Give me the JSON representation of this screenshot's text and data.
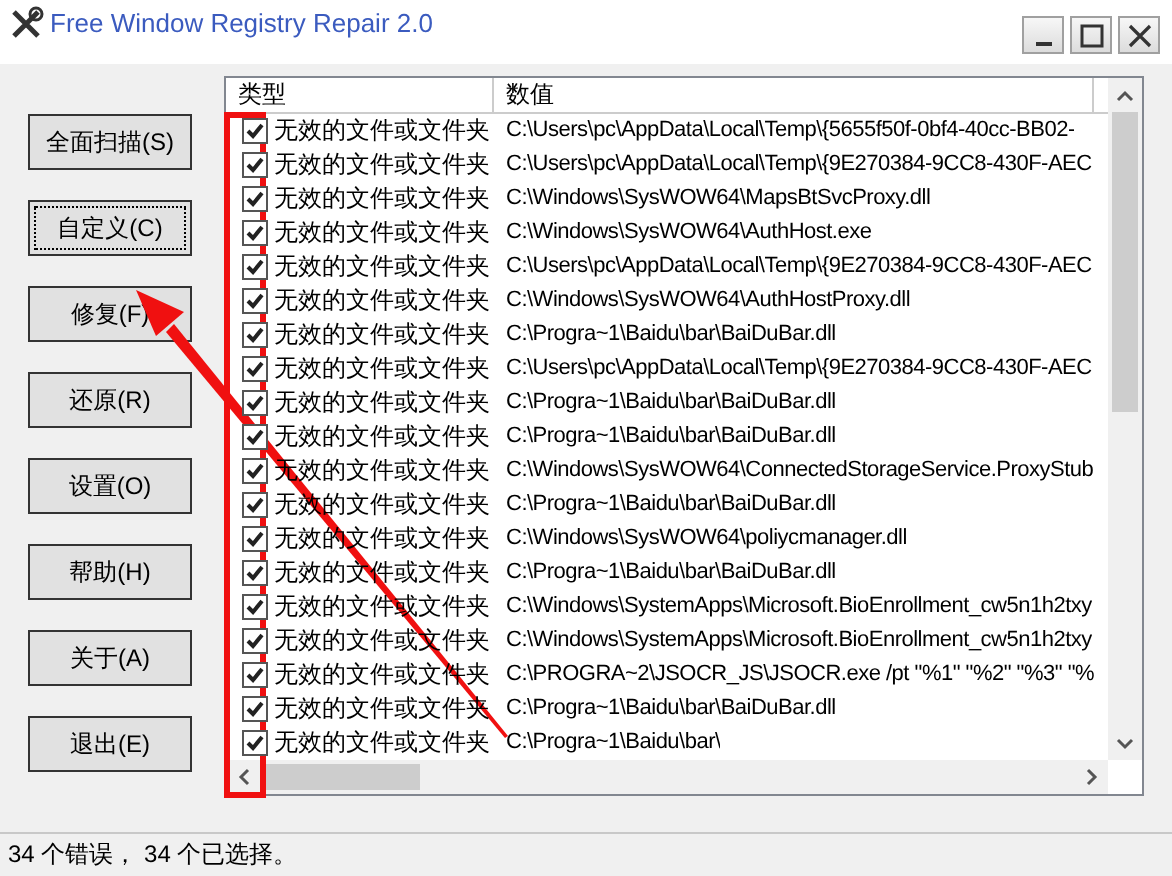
{
  "window": {
    "title": "Free Window Registry Repair 2.0"
  },
  "buttons": [
    {
      "label": "全面扫描(S)",
      "focused": false
    },
    {
      "label": "自定义(C)",
      "focused": true
    },
    {
      "label": "修复(F)",
      "focused": false
    },
    {
      "label": "还原(R)",
      "focused": false
    },
    {
      "label": "设置(O)",
      "focused": false
    },
    {
      "label": "帮助(H)",
      "focused": false
    },
    {
      "label": "关于(A)",
      "focused": false
    },
    {
      "label": "退出(E)",
      "focused": false
    }
  ],
  "table": {
    "columns": [
      "类型",
      "数值"
    ],
    "rows": [
      {
        "checked": true,
        "type": "无效的文件或文件夹",
        "value": "C:\\Users\\pc\\AppData\\Local\\Temp\\{5655f50f-0bf4-40cc-BB02-"
      },
      {
        "checked": true,
        "type": "无效的文件或文件夹",
        "value": "C:\\Users\\pc\\AppData\\Local\\Temp\\{9E270384-9CC8-430F-AEC"
      },
      {
        "checked": true,
        "type": "无效的文件或文件夹",
        "value": "C:\\Windows\\SysWOW64\\MapsBtSvcProxy.dll"
      },
      {
        "checked": true,
        "type": "无效的文件或文件夹",
        "value": "C:\\Windows\\SysWOW64\\AuthHost.exe"
      },
      {
        "checked": true,
        "type": "无效的文件或文件夹",
        "value": "C:\\Users\\pc\\AppData\\Local\\Temp\\{9E270384-9CC8-430F-AEC"
      },
      {
        "checked": true,
        "type": "无效的文件或文件夹",
        "value": "C:\\Windows\\SysWOW64\\AuthHostProxy.dll"
      },
      {
        "checked": true,
        "type": "无效的文件或文件夹",
        "value": "C:\\Progra~1\\Baidu\\bar\\BaiDuBar.dll"
      },
      {
        "checked": true,
        "type": "无效的文件或文件夹",
        "value": "C:\\Users\\pc\\AppData\\Local\\Temp\\{9E270384-9CC8-430F-AEC"
      },
      {
        "checked": true,
        "type": "无效的文件或文件夹",
        "value": "C:\\Progra~1\\Baidu\\bar\\BaiDuBar.dll"
      },
      {
        "checked": true,
        "type": "无效的文件或文件夹",
        "value": "C:\\Progra~1\\Baidu\\bar\\BaiDuBar.dll"
      },
      {
        "checked": true,
        "type": "无效的文件或文件夹",
        "value": "C:\\Windows\\SysWOW64\\ConnectedStorageService.ProxyStub"
      },
      {
        "checked": true,
        "type": "无效的文件或文件夹",
        "value": "C:\\Progra~1\\Baidu\\bar\\BaiDuBar.dll"
      },
      {
        "checked": true,
        "type": "无效的文件或文件夹",
        "value": "C:\\Windows\\SysWOW64\\poliycmanager.dll"
      },
      {
        "checked": true,
        "type": "无效的文件或文件夹",
        "value": "C:\\Progra~1\\Baidu\\bar\\BaiDuBar.dll"
      },
      {
        "checked": true,
        "type": "无效的文件或文件夹",
        "value": "C:\\Windows\\SystemApps\\Microsoft.BioEnrollment_cw5n1h2txy"
      },
      {
        "checked": true,
        "type": "无效的文件或文件夹",
        "value": "C:\\Windows\\SystemApps\\Microsoft.BioEnrollment_cw5n1h2txy"
      },
      {
        "checked": true,
        "type": "无效的文件或文件夹",
        "value": "C:\\PROGRA~2\\JSOCR_JS\\JSOCR.exe /pt \"%1\" \"%2\" \"%3\" \"%"
      },
      {
        "checked": true,
        "type": "无效的文件或文件夹",
        "value": "C:\\Progra~1\\Baidu\\bar\\BaiDuBar.dll"
      },
      {
        "checked": true,
        "type": "无效的文件或文件夹",
        "value": "C:\\Progra~1\\Baidu\\bar\\"
      }
    ]
  },
  "status_bar": "34 个错误，  34 个已选择。"
}
